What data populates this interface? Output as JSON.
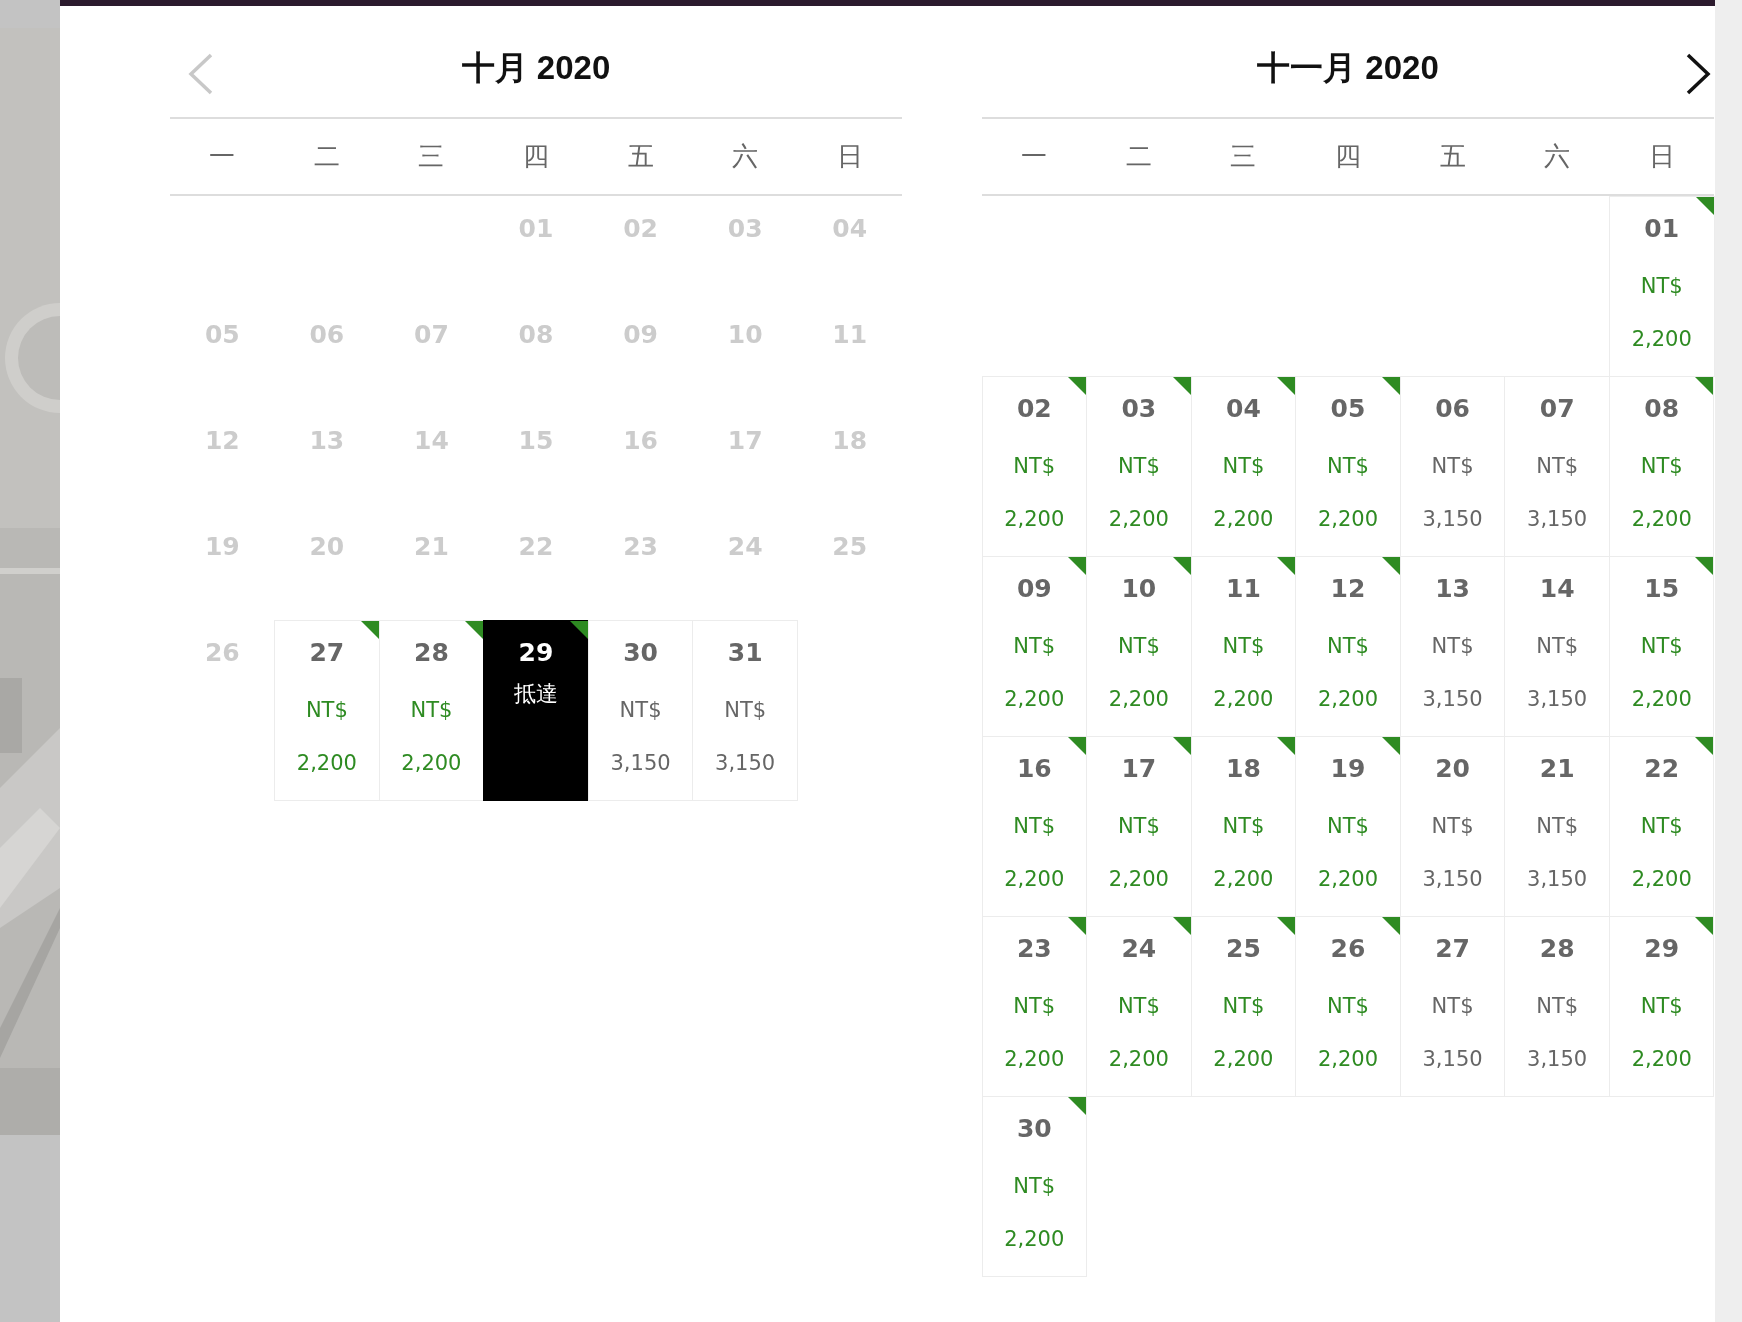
{
  "months": [
    {
      "title": "十月 2020",
      "prev_button": {
        "disabled": true
      },
      "weekdays": [
        "一",
        "二",
        "三",
        "四",
        "五",
        "六",
        "日"
      ],
      "weeks": [
        {
          "kind": "first",
          "days": [
            {
              "day": "01",
              "kind": "past"
            },
            {
              "day": "02",
              "kind": "past"
            },
            {
              "day": "03",
              "kind": "past"
            },
            {
              "day": "04",
              "kind": "past"
            }
          ]
        },
        {
          "kind": "full",
          "days": [
            {
              "day": "05",
              "kind": "past"
            },
            {
              "day": "06",
              "kind": "past"
            },
            {
              "day": "07",
              "kind": "past"
            },
            {
              "day": "08",
              "kind": "past"
            },
            {
              "day": "09",
              "kind": "past"
            },
            {
              "day": "10",
              "kind": "past"
            },
            {
              "day": "11",
              "kind": "past"
            }
          ]
        },
        {
          "kind": "full",
          "days": [
            {
              "day": "12",
              "kind": "past"
            },
            {
              "day": "13",
              "kind": "past"
            },
            {
              "day": "14",
              "kind": "past"
            },
            {
              "day": "15",
              "kind": "past"
            },
            {
              "day": "16",
              "kind": "past"
            },
            {
              "day": "17",
              "kind": "past"
            },
            {
              "day": "18",
              "kind": "past"
            }
          ]
        },
        {
          "kind": "full",
          "days": [
            {
              "day": "19",
              "kind": "past"
            },
            {
              "day": "20",
              "kind": "past"
            },
            {
              "day": "21",
              "kind": "past"
            },
            {
              "day": "22",
              "kind": "past"
            },
            {
              "day": "23",
              "kind": "past"
            },
            {
              "day": "24",
              "kind": "past"
            },
            {
              "day": "25",
              "kind": "past"
            }
          ]
        },
        {
          "kind": "last",
          "days": [
            {
              "day": "26",
              "kind": "past"
            },
            {
              "day": "27",
              "kind": "price",
              "currency": "NT$",
              "price": "2,200",
              "promo": true,
              "selected": false
            },
            {
              "day": "28",
              "kind": "price",
              "currency": "NT$",
              "price": "2,200",
              "promo": true,
              "selected": false
            },
            {
              "day": "29",
              "kind": "price",
              "label": "抵達",
              "promo": true,
              "selected": true
            },
            {
              "day": "30",
              "kind": "price",
              "currency": "NT$",
              "price": "3,150",
              "promo": false,
              "selected": false
            },
            {
              "day": "31",
              "kind": "price",
              "currency": "NT$",
              "price": "3,150",
              "promo": false,
              "selected": false
            }
          ]
        }
      ]
    },
    {
      "title": "十一月 2020",
      "next_button": {
        "disabled": false
      },
      "weekdays": [
        "一",
        "二",
        "三",
        "四",
        "五",
        "六",
        "日"
      ],
      "weeks": [
        {
          "kind": "first",
          "days": [
            {
              "day": "01",
              "kind": "price",
              "currency": "NT$",
              "price": "2,200",
              "promo": true,
              "selected": false
            }
          ]
        },
        {
          "kind": "full",
          "days": [
            {
              "day": "02",
              "kind": "price",
              "currency": "NT$",
              "price": "2,200",
              "promo": true,
              "selected": false
            },
            {
              "day": "03",
              "kind": "price",
              "currency": "NT$",
              "price": "2,200",
              "promo": true,
              "selected": false
            },
            {
              "day": "04",
              "kind": "price",
              "currency": "NT$",
              "price": "2,200",
              "promo": true,
              "selected": false
            },
            {
              "day": "05",
              "kind": "price",
              "currency": "NT$",
              "price": "2,200",
              "promo": true,
              "selected": false
            },
            {
              "day": "06",
              "kind": "price",
              "currency": "NT$",
              "price": "3,150",
              "promo": false,
              "selected": false
            },
            {
              "day": "07",
              "kind": "price",
              "currency": "NT$",
              "price": "3,150",
              "promo": false,
              "selected": false
            },
            {
              "day": "08",
              "kind": "price",
              "currency": "NT$",
              "price": "2,200",
              "promo": true,
              "selected": false
            }
          ]
        },
        {
          "kind": "full",
          "days": [
            {
              "day": "09",
              "kind": "price",
              "currency": "NT$",
              "price": "2,200",
              "promo": true,
              "selected": false
            },
            {
              "day": "10",
              "kind": "price",
              "currency": "NT$",
              "price": "2,200",
              "promo": true,
              "selected": false
            },
            {
              "day": "11",
              "kind": "price",
              "currency": "NT$",
              "price": "2,200",
              "promo": true,
              "selected": false
            },
            {
              "day": "12",
              "kind": "price",
              "currency": "NT$",
              "price": "2,200",
              "promo": true,
              "selected": false
            },
            {
              "day": "13",
              "kind": "price",
              "currency": "NT$",
              "price": "3,150",
              "promo": false,
              "selected": false
            },
            {
              "day": "14",
              "kind": "price",
              "currency": "NT$",
              "price": "3,150",
              "promo": false,
              "selected": false
            },
            {
              "day": "15",
              "kind": "price",
              "currency": "NT$",
              "price": "2,200",
              "promo": true,
              "selected": false
            }
          ]
        },
        {
          "kind": "full",
          "days": [
            {
              "day": "16",
              "kind": "price",
              "currency": "NT$",
              "price": "2,200",
              "promo": true,
              "selected": false
            },
            {
              "day": "17",
              "kind": "price",
              "currency": "NT$",
              "price": "2,200",
              "promo": true,
              "selected": false
            },
            {
              "day": "18",
              "kind": "price",
              "currency": "NT$",
              "price": "2,200",
              "promo": true,
              "selected": false
            },
            {
              "day": "19",
              "kind": "price",
              "currency": "NT$",
              "price": "2,200",
              "promo": true,
              "selected": false
            },
            {
              "day": "20",
              "kind": "price",
              "currency": "NT$",
              "price": "3,150",
              "promo": false,
              "selected": false
            },
            {
              "day": "21",
              "kind": "price",
              "currency": "NT$",
              "price": "3,150",
              "promo": false,
              "selected": false
            },
            {
              "day": "22",
              "kind": "price",
              "currency": "NT$",
              "price": "2,200",
              "promo": true,
              "selected": false
            }
          ]
        },
        {
          "kind": "full",
          "days": [
            {
              "day": "23",
              "kind": "price",
              "currency": "NT$",
              "price": "2,200",
              "promo": true,
              "selected": false
            },
            {
              "day": "24",
              "kind": "price",
              "currency": "NT$",
              "price": "2,200",
              "promo": true,
              "selected": false
            },
            {
              "day": "25",
              "kind": "price",
              "currency": "NT$",
              "price": "2,200",
              "promo": true,
              "selected": false
            },
            {
              "day": "26",
              "kind": "price",
              "currency": "NT$",
              "price": "2,200",
              "promo": true,
              "selected": false
            },
            {
              "day": "27",
              "kind": "price",
              "currency": "NT$",
              "price": "3,150",
              "promo": false,
              "selected": false
            },
            {
              "day": "28",
              "kind": "price",
              "currency": "NT$",
              "price": "3,150",
              "promo": false,
              "selected": false
            },
            {
              "day": "29",
              "kind": "price",
              "currency": "NT$",
              "price": "2,200",
              "promo": true,
              "selected": false
            }
          ]
        },
        {
          "kind": "last",
          "days": [
            {
              "day": "30",
              "kind": "price",
              "currency": "NT$",
              "price": "2,200",
              "promo": true,
              "selected": false
            }
          ]
        }
      ]
    }
  ]
}
